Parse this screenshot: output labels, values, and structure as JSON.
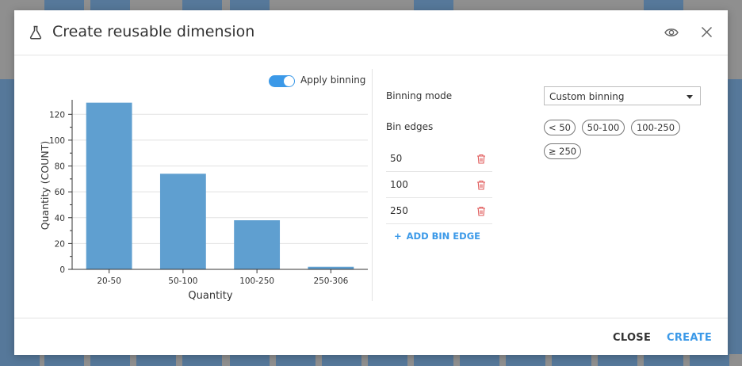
{
  "modal": {
    "title": "Create reusable dimension",
    "icon": "flask-icon",
    "header_icons": [
      "eye-icon",
      "close-icon"
    ]
  },
  "toggle": {
    "label": "Apply binning",
    "on": true
  },
  "form": {
    "binning_mode_label": "Binning mode",
    "binning_mode_value": "Custom binning",
    "bin_edges_label": "Bin edges",
    "bin_edges": [
      "50",
      "100",
      "250"
    ],
    "add_bin_edge_label": "ADD BIN EDGE",
    "bin_chips": [
      "< 50",
      "50-100",
      "100-250",
      "≥ 250"
    ]
  },
  "footer": {
    "close_label": "CLOSE",
    "create_label": "CREATE"
  },
  "colors": {
    "accent": "#3b99e8",
    "bar": "#5f9fd0",
    "trash": "#e05a5a"
  },
  "chart_data": {
    "type": "bar",
    "categories": [
      "20-50",
      "50-100",
      "100-250",
      "250-306"
    ],
    "values": [
      129,
      74,
      38,
      2
    ],
    "xlabel": "Quantity",
    "ylabel": "Quantity (COUNT)",
    "ylim": [
      0,
      130
    ],
    "yticks": [
      0,
      20,
      40,
      60,
      80,
      100,
      120
    ],
    "grid": true
  }
}
